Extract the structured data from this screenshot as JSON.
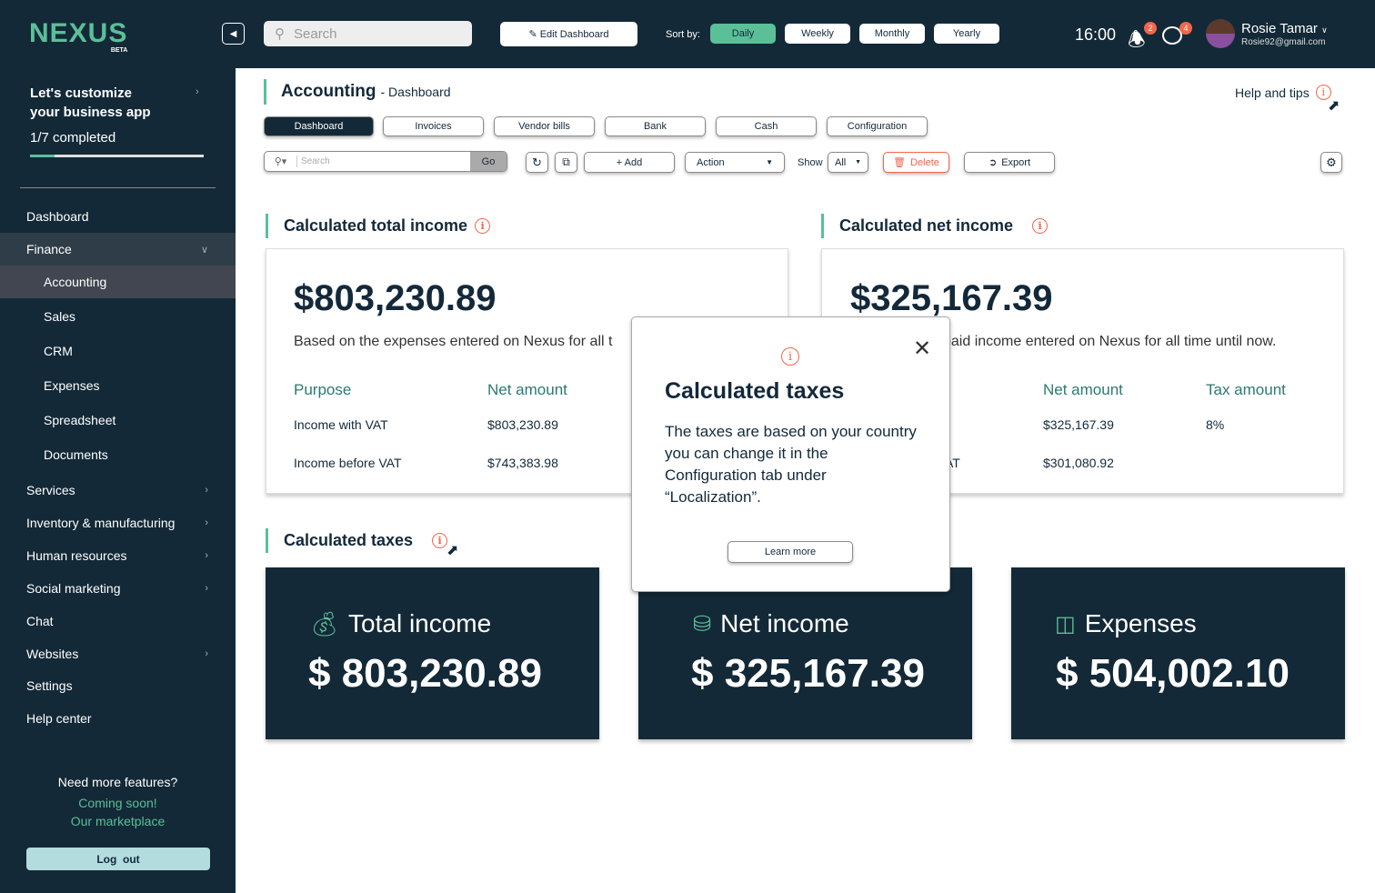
{
  "brand": {
    "name": "NEXUS",
    "tag": "BETA"
  },
  "colors": {
    "navy": "#132937",
    "accent": "#5bbf98",
    "alert": "#f2664b"
  },
  "topbar": {
    "search_placeholder": "Search",
    "edit_dashboard": "Edit Dashboard",
    "sort_by": "Sort by:",
    "sort_options": [
      "Daily",
      "Weekly",
      "Monthly",
      "Yearly"
    ],
    "sort_selected": "Daily",
    "time": "16:00",
    "notifications": "2",
    "messages": "4",
    "user_name": "Rosie Tamar",
    "user_email": "Rosie92@gmail.com"
  },
  "sidebar": {
    "onboarding_title_1": "Let's customize",
    "onboarding_title_2": "your business app",
    "progress_label": "1/7 completed",
    "progress_fraction": 0.143,
    "items": [
      "Dashboard",
      "Finance",
      "Accounting",
      "Sales",
      "CRM",
      "Expenses",
      "Spreadsheet",
      "Documents",
      "Services",
      "Inventory & manufacturing",
      "Human resources",
      "Social marketing",
      "Chat",
      "Websites",
      "Settings",
      "Help center"
    ],
    "more_features": "Need more features?",
    "coming_soon": "Coming soon!",
    "marketplace": "Our marketplace",
    "logout": "Log  out"
  },
  "page": {
    "title": "Accounting",
    "subtitle": "- Dashboard",
    "help": "Help and tips",
    "tabs": [
      "Dashboard",
      "Invoices",
      "Vendor bills",
      "Bank",
      "Cash",
      "Configuration"
    ],
    "active_tab": "Dashboard",
    "toolbar": {
      "search_placeholder": "Search",
      "go": "Go",
      "add": "+ Add",
      "action": "Action",
      "show": "Show",
      "show_value": "All",
      "delete": "Delete",
      "export": "Export"
    }
  },
  "total_income": {
    "heading": "Calculated total income",
    "amount": "$803,230.89",
    "description": "Based on the expenses entered on Nexus for all t",
    "col_purpose": "Purpose",
    "col_net": "Net amount",
    "rows": [
      {
        "purpose": "Income with VAT",
        "net": "$803,230.89"
      },
      {
        "purpose": "Income before VAT",
        "net": "$743,383.98"
      }
    ]
  },
  "net_income": {
    "heading": "Calculated net income",
    "amount": "$325,167.39",
    "description": "paid income entered on Nexus for all time until now.",
    "col_net": "Net amount",
    "col_tax": "Tax amount",
    "rows": [
      {
        "purpose": "",
        "net": "$325,167.39",
        "tax": "8%"
      },
      {
        "purpose": "AT",
        "net": "$301,080.92",
        "tax": ""
      }
    ]
  },
  "taxes": {
    "heading": "Calculated taxes",
    "cards": [
      {
        "label": "Total income",
        "value": "$ 803,230.89",
        "icon": "money-bag-icon"
      },
      {
        "label": "Net income",
        "value": "$ 325,167.39",
        "icon": "coins-icon"
      },
      {
        "label": "Expenses",
        "value": "$ 504,002.10",
        "icon": "hand-cash-icon"
      }
    ]
  },
  "popover": {
    "title": "Calculated taxes",
    "body": "The taxes are based on your country you can change it in the Configuration tab under “Localization”.",
    "button": "Learn more"
  }
}
